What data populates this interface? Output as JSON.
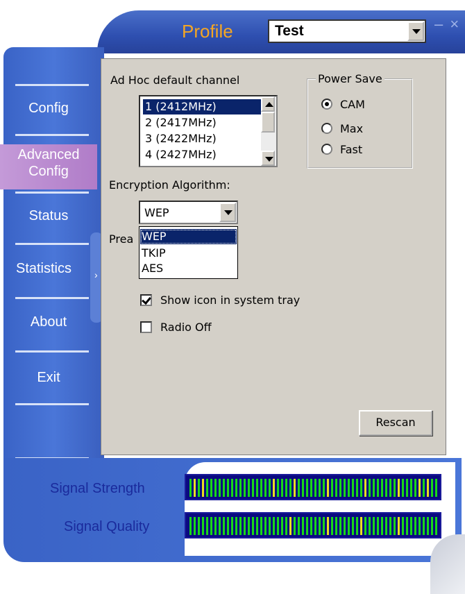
{
  "header": {
    "profile_label": "Profile",
    "profile_value": "Test",
    "window_controls": "– ×"
  },
  "sidebar": {
    "items": [
      {
        "label": "Config"
      },
      {
        "label": "Advanced\nConfig",
        "line1": "Advanced",
        "line2": "Config"
      },
      {
        "label": "Status"
      },
      {
        "label": "Statistics"
      },
      {
        "label": "About"
      },
      {
        "label": "Exit"
      }
    ],
    "active": "Advanced Config"
  },
  "main": {
    "adhoc_label": "Ad Hoc default channel",
    "channels": [
      "1 (2412MHz)",
      "2 (2417MHz)",
      "3 (2422MHz)",
      "4 (2427MHz)"
    ],
    "channel_selected": "1 (2412MHz)",
    "power_save": {
      "title": "Power Save",
      "options": [
        "CAM",
        "Max",
        "Fast"
      ],
      "selected": "CAM"
    },
    "encryption_label": "Encryption Algorithm:",
    "encryption_value": "WEP",
    "encryption_options": [
      "WEP",
      "TKIP",
      "AES"
    ],
    "preamble_label_partial": "Prea",
    "show_icon_label": "Show icon in system tray",
    "show_icon_checked": true,
    "radio_off_label": "Radio Off",
    "radio_off_checked": false,
    "rescan_label": "Rescan"
  },
  "signal": {
    "strength_label": "Signal Strength",
    "quality_label": "Signal Quality",
    "colors": {
      "bar_green": "#18d818",
      "bar_yellow": "#e8e020",
      "meter_bg": "#0a0a80"
    }
  }
}
